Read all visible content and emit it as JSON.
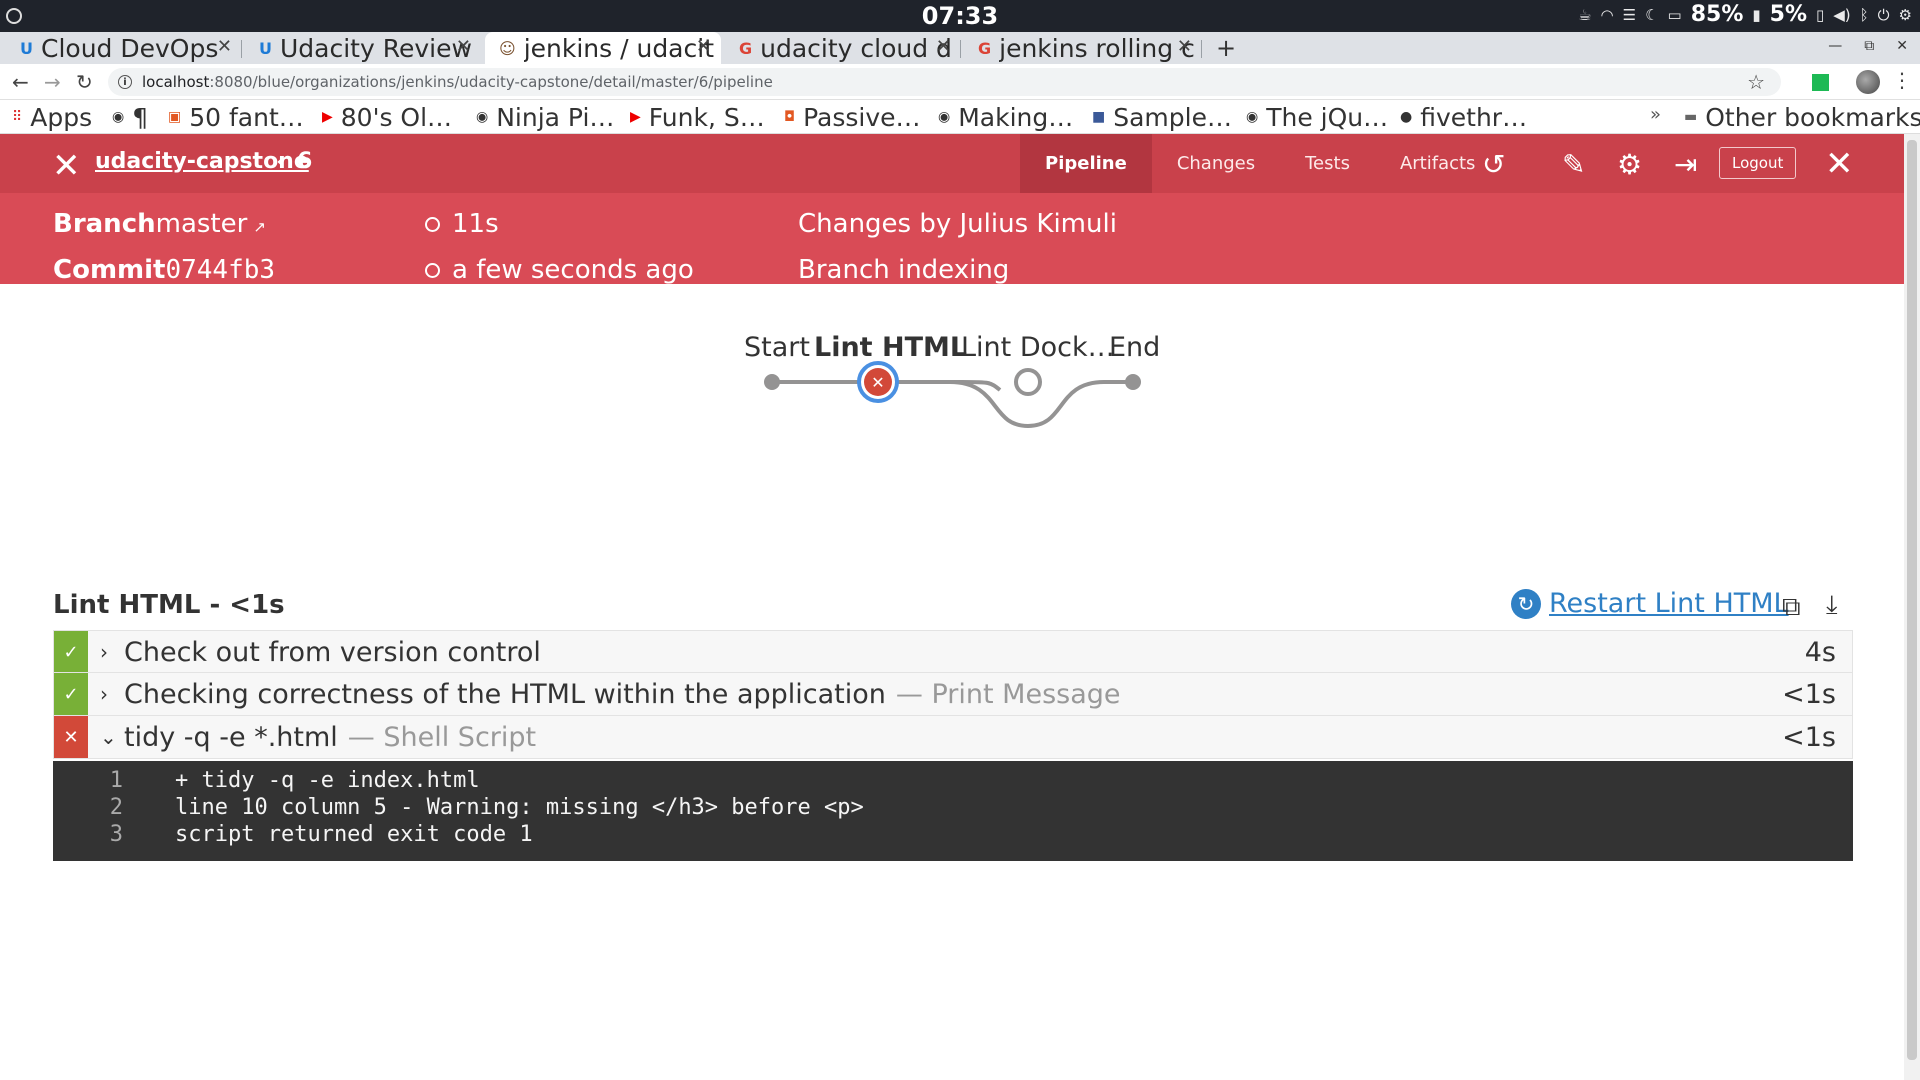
{
  "os": {
    "clock": "07:33",
    "battery1": "85%",
    "battery2": "5%"
  },
  "tabs": [
    {
      "title": "Cloud DevOps",
      "favicon": "udacity-icon"
    },
    {
      "title": "Udacity Review",
      "favicon": "udacity-icon"
    },
    {
      "title": "jenkins / udacit",
      "favicon": "jenkins-icon"
    },
    {
      "title": "udacity cloud d",
      "favicon": "google-icon"
    },
    {
      "title": "jenkins rolling c",
      "favicon": "google-icon"
    }
  ],
  "address": {
    "host": "localhost",
    "path": ":8080/blue/organizations/jenkins/udacity-capstone/detail/master/6/pipeline"
  },
  "bookmarks": [
    "Apps",
    "¶",
    "50 fant…",
    "80's Ol…",
    "Ninja Pi…",
    "Funk, S…",
    "Passive…",
    "Making…",
    "Sample…",
    "The jQu…",
    "fivethr…"
  ],
  "bookmarks_more": "»",
  "other_bookmarks": "Other bookmarks",
  "jenkins": {
    "pipeline_name": "udacity-capstone",
    "run_number": "6",
    "tabs": [
      "Pipeline",
      "Changes",
      "Tests",
      "Artifacts"
    ],
    "logout": "Logout",
    "summary": {
      "branch_label": "Branch",
      "branch_value": "master",
      "commit_label": "Commit",
      "commit_value": "0744fb3",
      "duration": "11s",
      "time": "a few seconds ago",
      "changes": "Changes by Julius Kimuli",
      "cause": "Branch indexing"
    },
    "graph": {
      "stages": [
        "Start",
        "Lint HTML",
        "Lint Dock…",
        "End"
      ],
      "status": [
        "done",
        "failed",
        "pending",
        "done"
      ]
    },
    "stage_title": "Lint HTML - <1s",
    "restart_label": "Restart Lint HTML",
    "steps": [
      {
        "name": "Check out from version control",
        "sub": "",
        "duration": "4s",
        "status": "ok"
      },
      {
        "name": "Checking correctness of the HTML within the application",
        "sub": "— Print Message",
        "duration": "<1s",
        "status": "ok"
      },
      {
        "name": "tidy -q -e *.html",
        "sub": "— Shell Script",
        "duration": "<1s",
        "status": "fail"
      }
    ],
    "log": [
      {
        "n": "1",
        "text": "+ tidy -q -e index.html"
      },
      {
        "n": "2",
        "text": "line 10 column 5 - Warning: missing </h3> before <p>"
      },
      {
        "n": "3",
        "text": "script returned exit code 1"
      }
    ]
  },
  "colors": {
    "header": "#c9414b",
    "summary": "#d94b56",
    "success": "#78b037",
    "failure": "#d24939",
    "link": "#2f80c5"
  }
}
